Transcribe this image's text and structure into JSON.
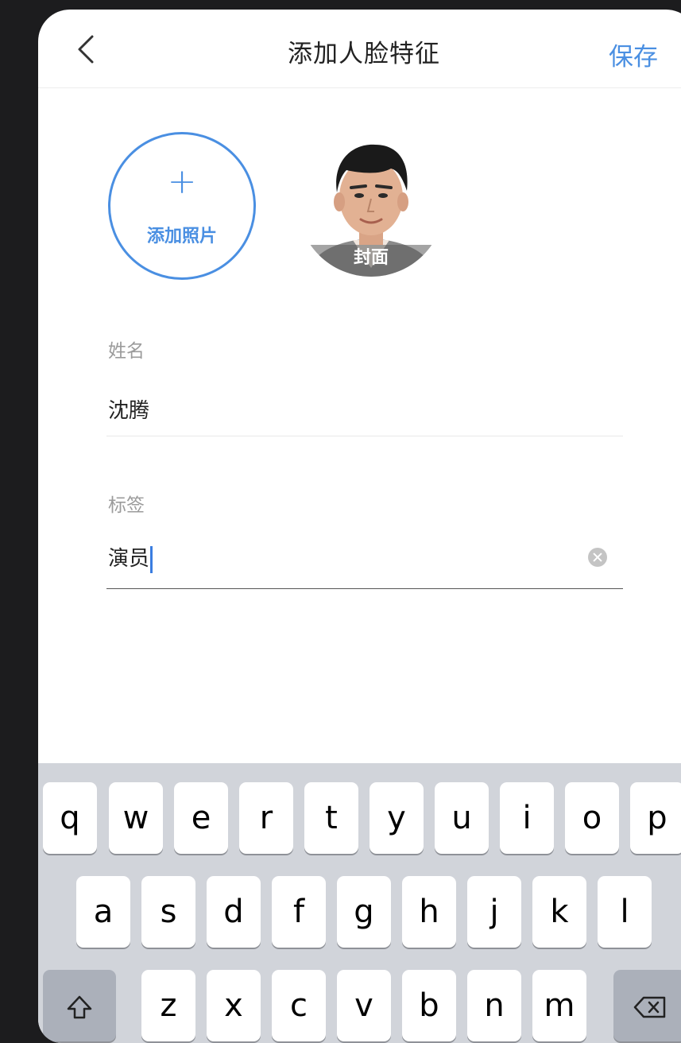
{
  "navbar": {
    "title": "添加人脸特征",
    "save_label": "保存",
    "back_icon": "chevron-left-icon"
  },
  "photos": {
    "add_label": "添加照片",
    "add_symbol": "+",
    "cover_label": "封面"
  },
  "form": {
    "name_label": "姓名",
    "name_value": "沈腾",
    "tag_label": "标签",
    "tag_value": "演员"
  },
  "keyboard": {
    "row1": [
      "q",
      "w",
      "e",
      "r",
      "t",
      "y",
      "u",
      "i",
      "o",
      "p"
    ],
    "row2": [
      "a",
      "s",
      "d",
      "f",
      "g",
      "h",
      "j",
      "k",
      "l"
    ],
    "row3": [
      "z",
      "x",
      "c",
      "v",
      "b",
      "n",
      "m"
    ],
    "shift_icon": "shift-icon",
    "backspace_icon": "backspace-icon"
  },
  "colors": {
    "accent": "#4a8fe2",
    "background": "#1c1c1e",
    "keyboard": "#d1d4da"
  }
}
